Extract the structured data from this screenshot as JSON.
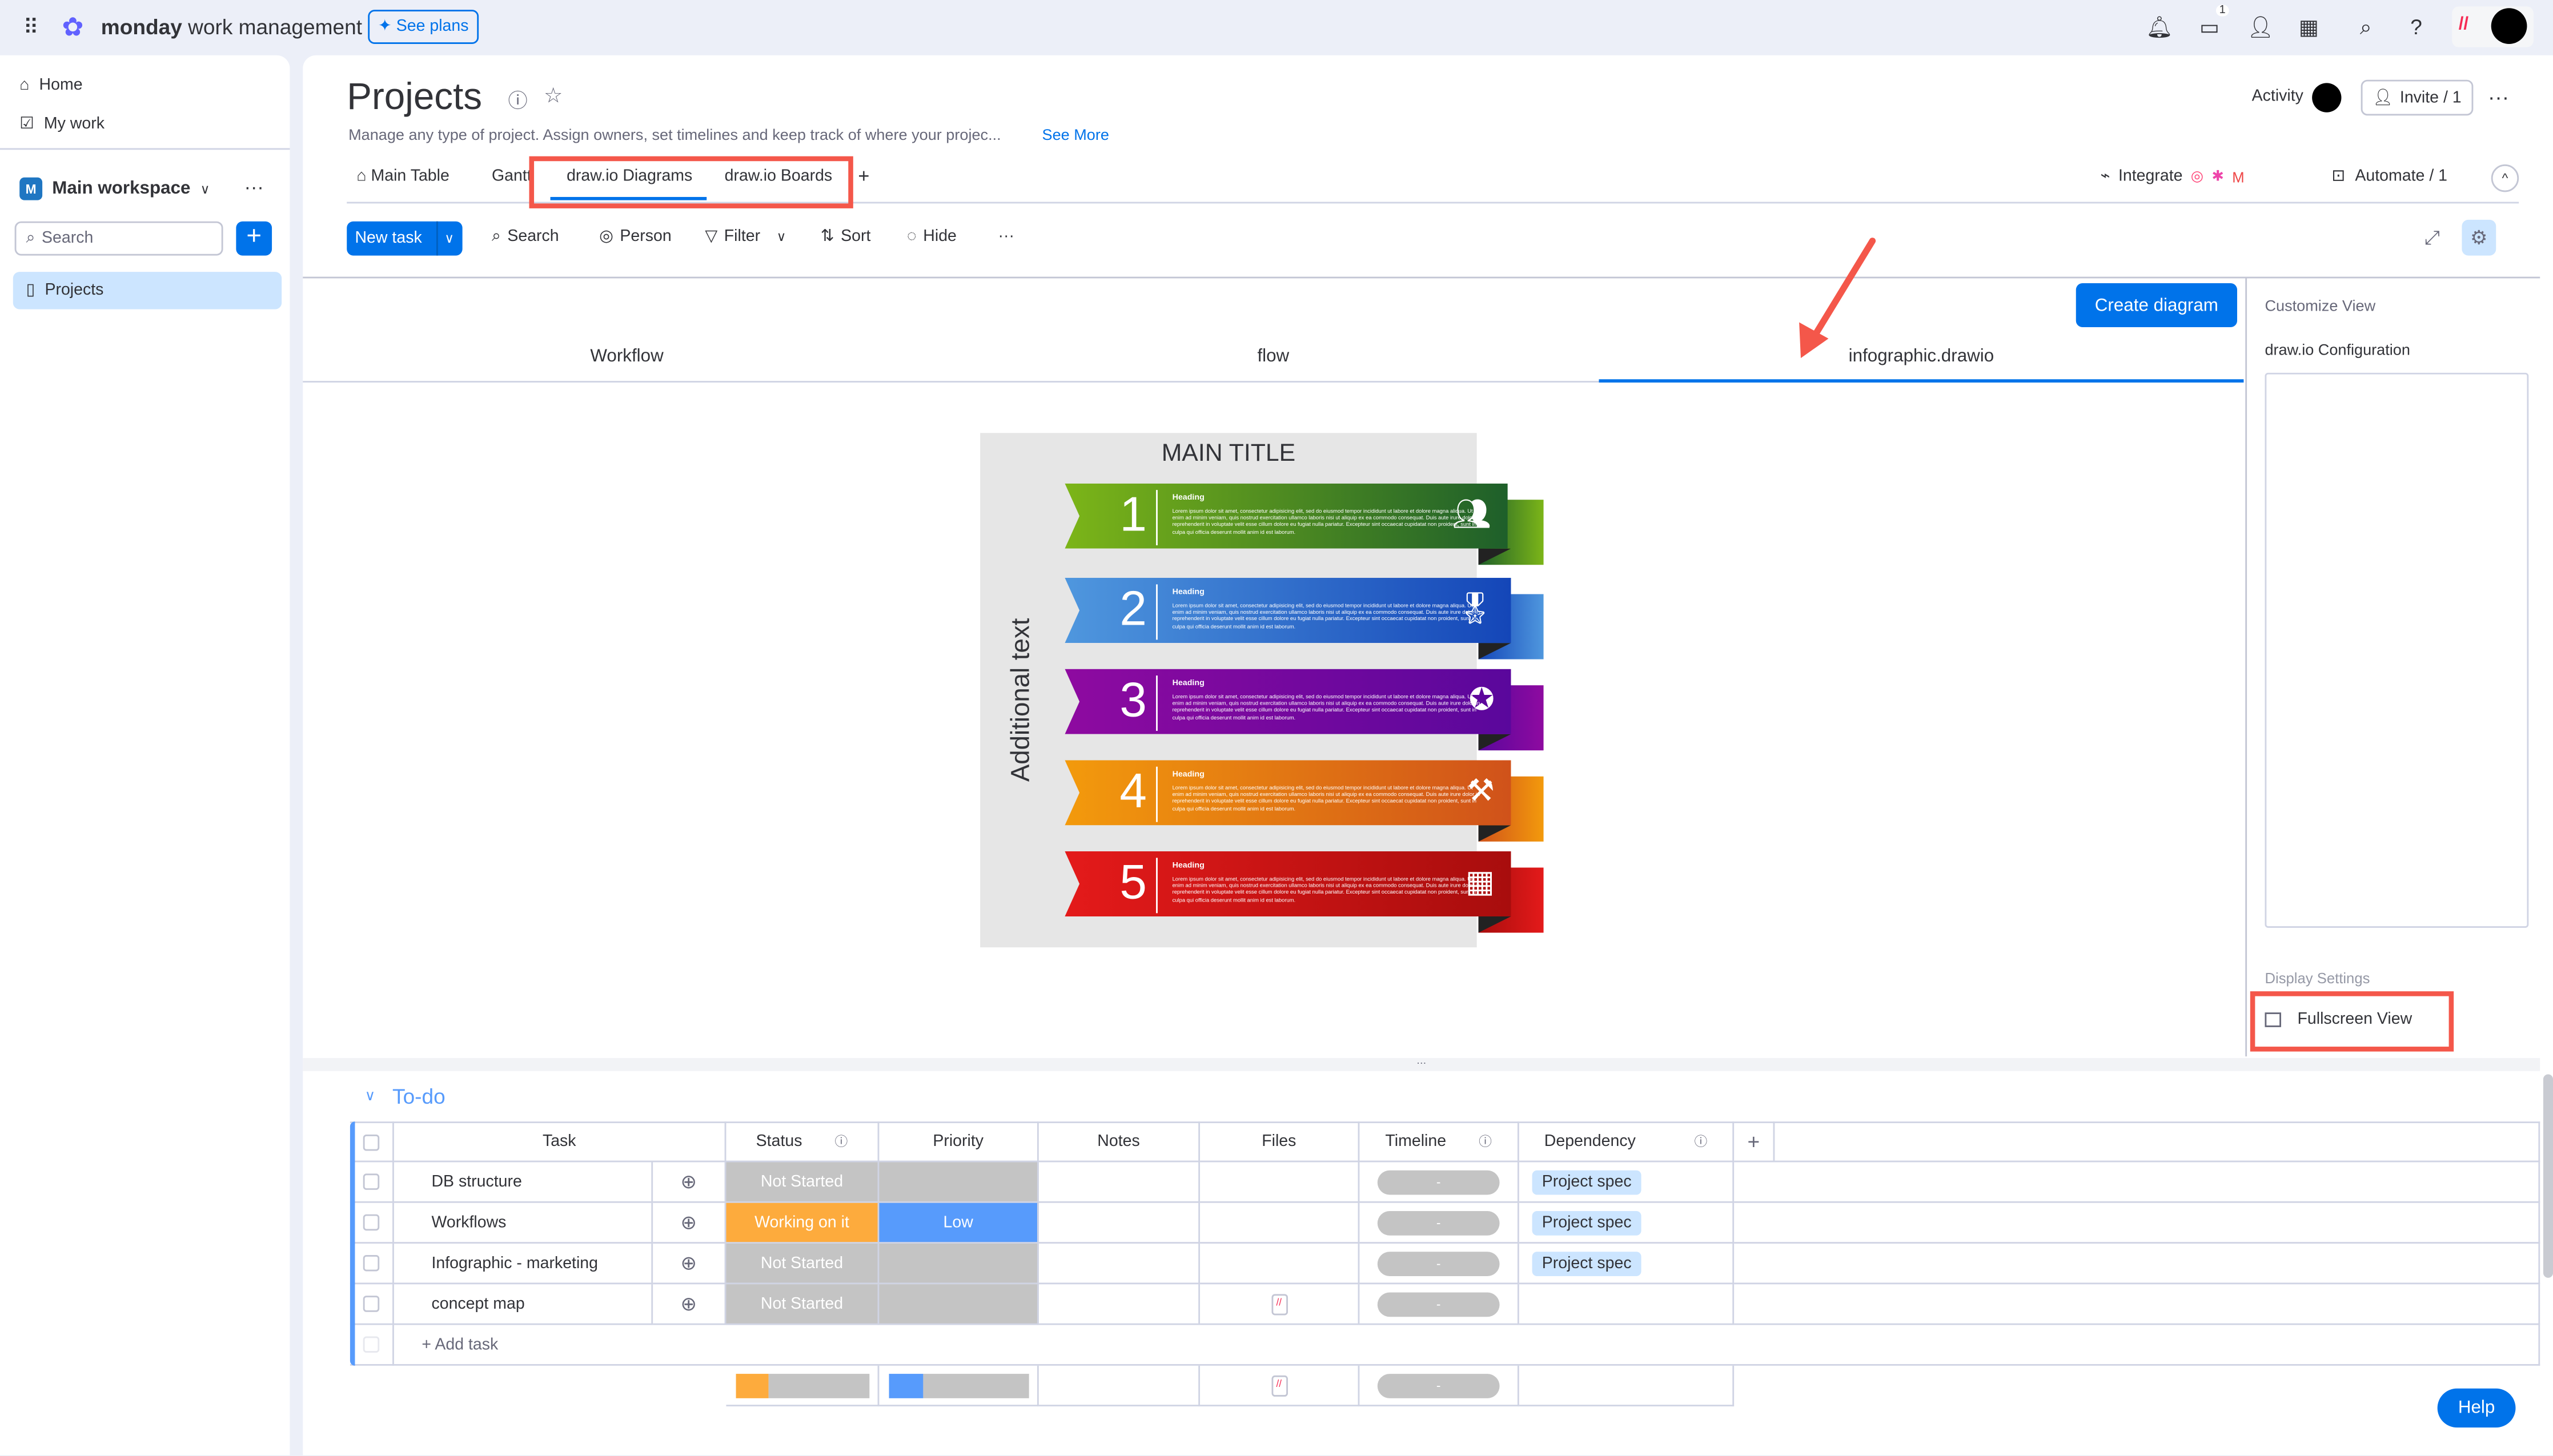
{
  "topbar": {
    "brand_bold": "monday",
    "brand_rest": " work management",
    "see_plans": "See plans",
    "inbox_badge": "1"
  },
  "sidebar": {
    "home": "Home",
    "my_work": "My work",
    "workspace": "Main workspace",
    "workspace_initial": "M",
    "search_placeholder": "Search",
    "items": [
      {
        "label": "Projects"
      }
    ]
  },
  "board": {
    "title": "Projects",
    "description": "Manage any type of project. Assign owners, set timelines and keep track of where your projec...",
    "see_more": "See More",
    "activity": "Activity",
    "invite": "Invite / 1",
    "views": [
      "Main Table",
      "Gantt",
      "draw.io Diagrams",
      "draw.io Boards"
    ],
    "active_view": "draw.io Diagrams",
    "integrate": "Integrate",
    "automate": "Automate / 1"
  },
  "toolbar": {
    "new_task": "New task",
    "search": "Search",
    "person": "Person",
    "filter": "Filter",
    "sort": "Sort",
    "hide": "Hide"
  },
  "diagram": {
    "create": "Create diagram",
    "tabs": [
      "Workflow",
      "flow",
      "infographic.drawio"
    ],
    "active_tab": "infographic.drawio",
    "infographic": {
      "title": "MAIN TITLE",
      "side_text": "Additional text",
      "steps": [
        {
          "num": "1",
          "heading": "Heading",
          "icon": "people-icon",
          "from": "#7cb518",
          "to": "#1e5f2a"
        },
        {
          "num": "2",
          "heading": "Heading",
          "icon": "award-icon",
          "from": "#4f97de",
          "to": "#1446b8"
        },
        {
          "num": "3",
          "heading": "Heading",
          "icon": "badge-check-icon",
          "from": "#8e0aa0",
          "to": "#5a079c"
        },
        {
          "num": "4",
          "heading": "Heading",
          "icon": "tools-icon",
          "from": "#f39a0c",
          "to": "#d0521a"
        },
        {
          "num": "5",
          "heading": "Heading",
          "icon": "building-icon",
          "from": "#e41a1a",
          "to": "#a80d0d"
        }
      ],
      "body": "Lorem ipsum dolor sit amet, consectetur adipisicing elit, sed do eiusmod tempor incididunt ut labore et dolore magna aliqua. Ut enim ad minim veniam, quis nostrud exercitation ullamco laboris nisi ut aliquip ex ea commodo consequat. Duis aute irure dolor in reprehenderit in voluptate velit esse cillum dolore eu fugiat nulla pariatur. Excepteur sint occaecat cupidatat non proident, sunt in culpa qui officia deserunt mollit anim id est laborum."
    }
  },
  "panel": {
    "customize": "Customize View",
    "config": "draw.io Configuration",
    "display": "Display Settings",
    "fullscreen": "Fullscreen View"
  },
  "group": {
    "title": "To-do",
    "color": "#579bfc",
    "columns": [
      "Task",
      "Status",
      "Priority",
      "Notes",
      "Files",
      "Timeline",
      "Dependency"
    ],
    "rows": [
      {
        "task": "DB structure",
        "status": "Not Started",
        "status_color": "#c4c4c4",
        "priority": "",
        "priority_color": "#c4c4c4",
        "file": false,
        "timeline": "-",
        "dependency": "Project spec"
      },
      {
        "task": "Workflows",
        "status": "Working on it",
        "status_color": "#fdab3d",
        "priority": "Low",
        "priority_color": "#579bfc",
        "file": false,
        "timeline": "-",
        "dependency": "Project spec"
      },
      {
        "task": "Infographic - marketing",
        "status": "Not Started",
        "status_color": "#c4c4c4",
        "priority": "",
        "priority_color": "#c4c4c4",
        "file": false,
        "timeline": "-",
        "dependency": "Project spec"
      },
      {
        "task": "concept map",
        "status": "Not Started",
        "status_color": "#c4c4c4",
        "priority": "",
        "priority_color": "#c4c4c4",
        "file": true,
        "timeline": "-",
        "dependency": ""
      }
    ],
    "add_task": "+ Add task",
    "summary_timeline": "-"
  },
  "help": "Help"
}
